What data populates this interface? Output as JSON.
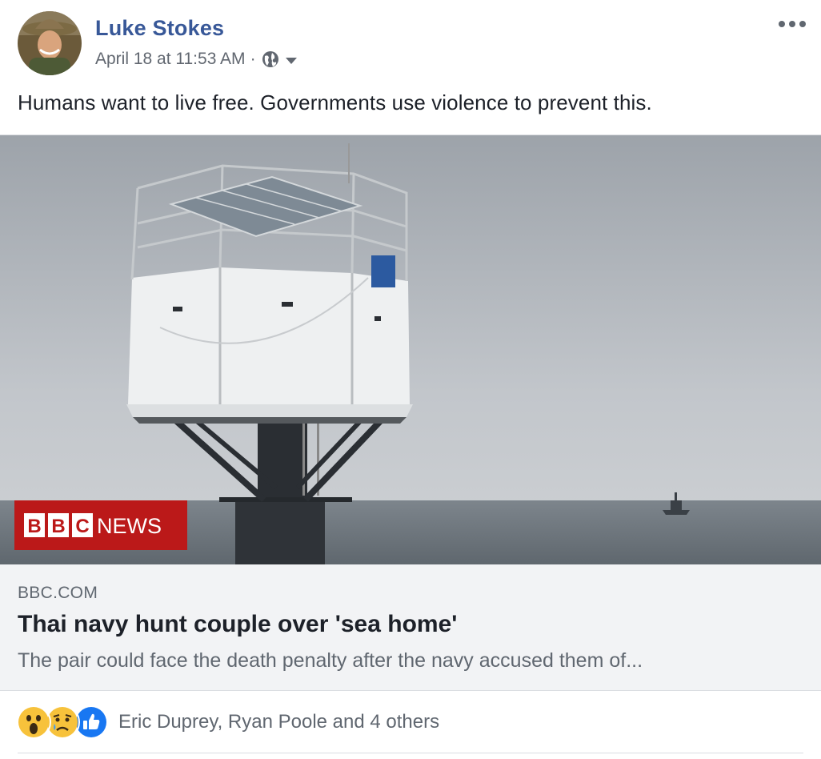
{
  "post": {
    "author": "Luke Stokes",
    "timestamp": "April 18 at 11:53 AM",
    "separator": "·",
    "privacy_icon": "globe-icon",
    "text": "Humans want to live free. Governments use violence to prevent this."
  },
  "link": {
    "domain": "BBC.COM",
    "title": "Thai navy hunt couple over 'sea home'",
    "description": "The pair could face the death penalty after the navy accused them of...",
    "image_logo": {
      "letters": [
        "B",
        "B",
        "C"
      ],
      "word": "NEWS"
    }
  },
  "reactions": {
    "icons": [
      "wow-reaction-icon",
      "sad-reaction-icon",
      "like-reaction-icon"
    ],
    "summary": "Eric Duprey, Ryan Poole and 4 others"
  },
  "colors": {
    "author_blue": "#385898",
    "bbc_red": "#bb1919",
    "like_blue": "#1877f2",
    "card_bg": "#f2f3f5"
  }
}
